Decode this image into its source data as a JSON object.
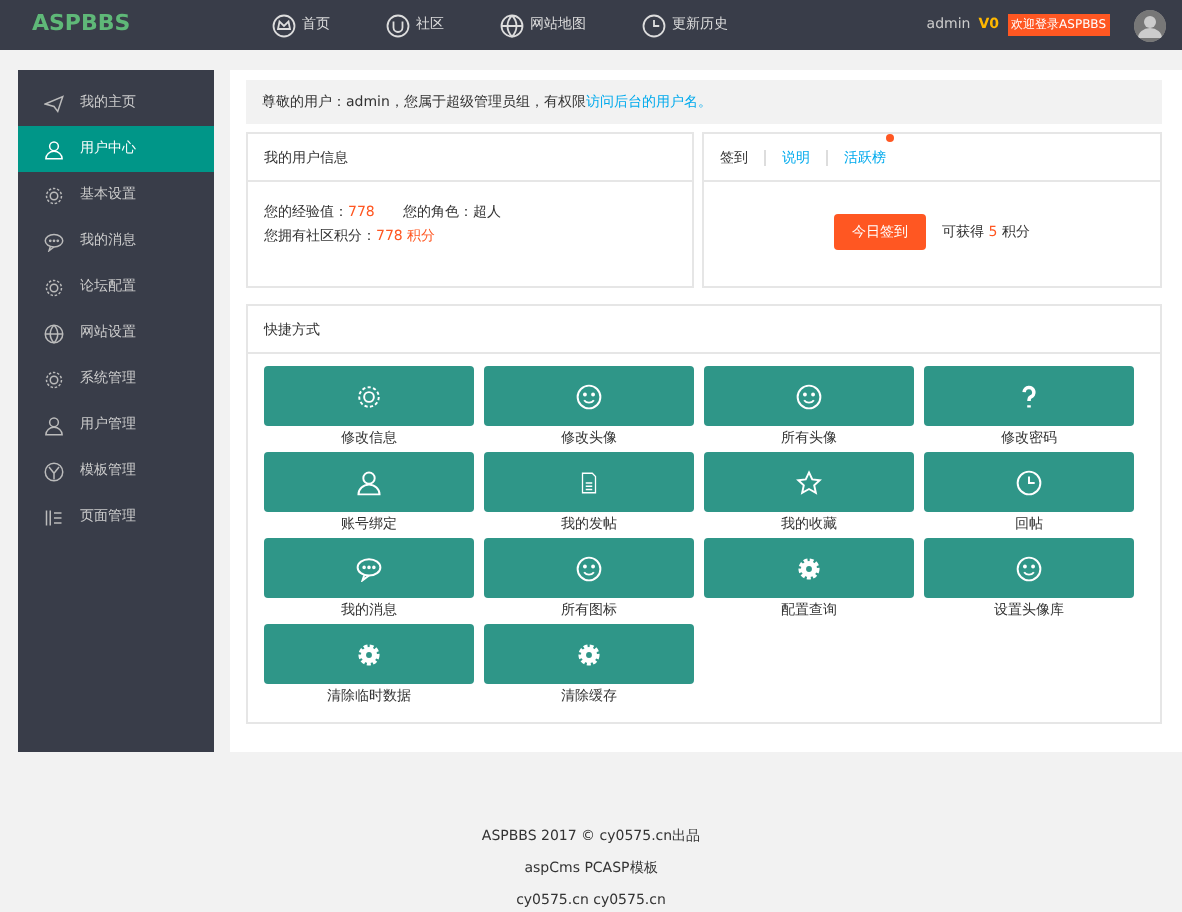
{
  "header": {
    "logo": "ASPBBS",
    "nav": [
      {
        "label": "首页"
      },
      {
        "label": "社区"
      },
      {
        "label": "网站地图"
      },
      {
        "label": "更新历史"
      }
    ],
    "user": "admin",
    "level": "V0",
    "badge": "欢迎登录ASPBBS"
  },
  "sidebar": {
    "items": [
      {
        "label": "我的主页",
        "selected": false
      },
      {
        "label": "用户中心",
        "selected": true
      },
      {
        "label": "基本设置",
        "selected": false
      },
      {
        "label": "我的消息",
        "selected": false
      },
      {
        "label": "论坛配置",
        "selected": false
      },
      {
        "label": "网站设置",
        "selected": false
      },
      {
        "label": "系统管理",
        "selected": false
      },
      {
        "label": "用户管理",
        "selected": false
      },
      {
        "label": "模板管理",
        "selected": false
      },
      {
        "label": "页面管理",
        "selected": false
      }
    ]
  },
  "notice": {
    "text": "尊敬的用户：admin，您属于超级管理员组，有权限",
    "link": "访问后台的用户名。"
  },
  "info": {
    "title": "我的用户信息",
    "lines": [
      [
        {
          "label": "您的经验值：",
          "value": "778"
        },
        {
          "label": "您的角色：",
          "value": "超人",
          "plain": true
        }
      ],
      [
        {
          "label": "您拥有社区积分：",
          "value": "778 积分"
        }
      ]
    ]
  },
  "signin": {
    "tabs": [
      {
        "label": "签到",
        "link": false,
        "dot": false
      },
      {
        "label": "说明",
        "link": true,
        "dot": false
      },
      {
        "label": "活跃榜",
        "link": true,
        "dot": true
      }
    ],
    "button": "今日签到",
    "reward_label": "可获得",
    "reward": "5",
    "reward_unit": "积分"
  },
  "shortcuts": {
    "title": "快捷方式",
    "items": [
      {
        "label": "修改信息"
      },
      {
        "label": "修改头像"
      },
      {
        "label": "所有头像"
      },
      {
        "label": "修改密码"
      },
      {
        "label": "账号绑定"
      },
      {
        "label": "我的发帖"
      },
      {
        "label": "我的收藏"
      },
      {
        "label": "回帖"
      },
      {
        "label": "我的消息"
      },
      {
        "label": "所有图标"
      },
      {
        "label": "配置查询"
      },
      {
        "label": "设置头像库"
      },
      {
        "label": "清除临时数据"
      },
      {
        "label": "清除缓存"
      }
    ]
  },
  "footer": {
    "lines": [
      "ASPBBS 2017 © cy0575.cn出品",
      "aspCms PCASP模板",
      "cy0575.cn cy0575.cn"
    ]
  }
}
